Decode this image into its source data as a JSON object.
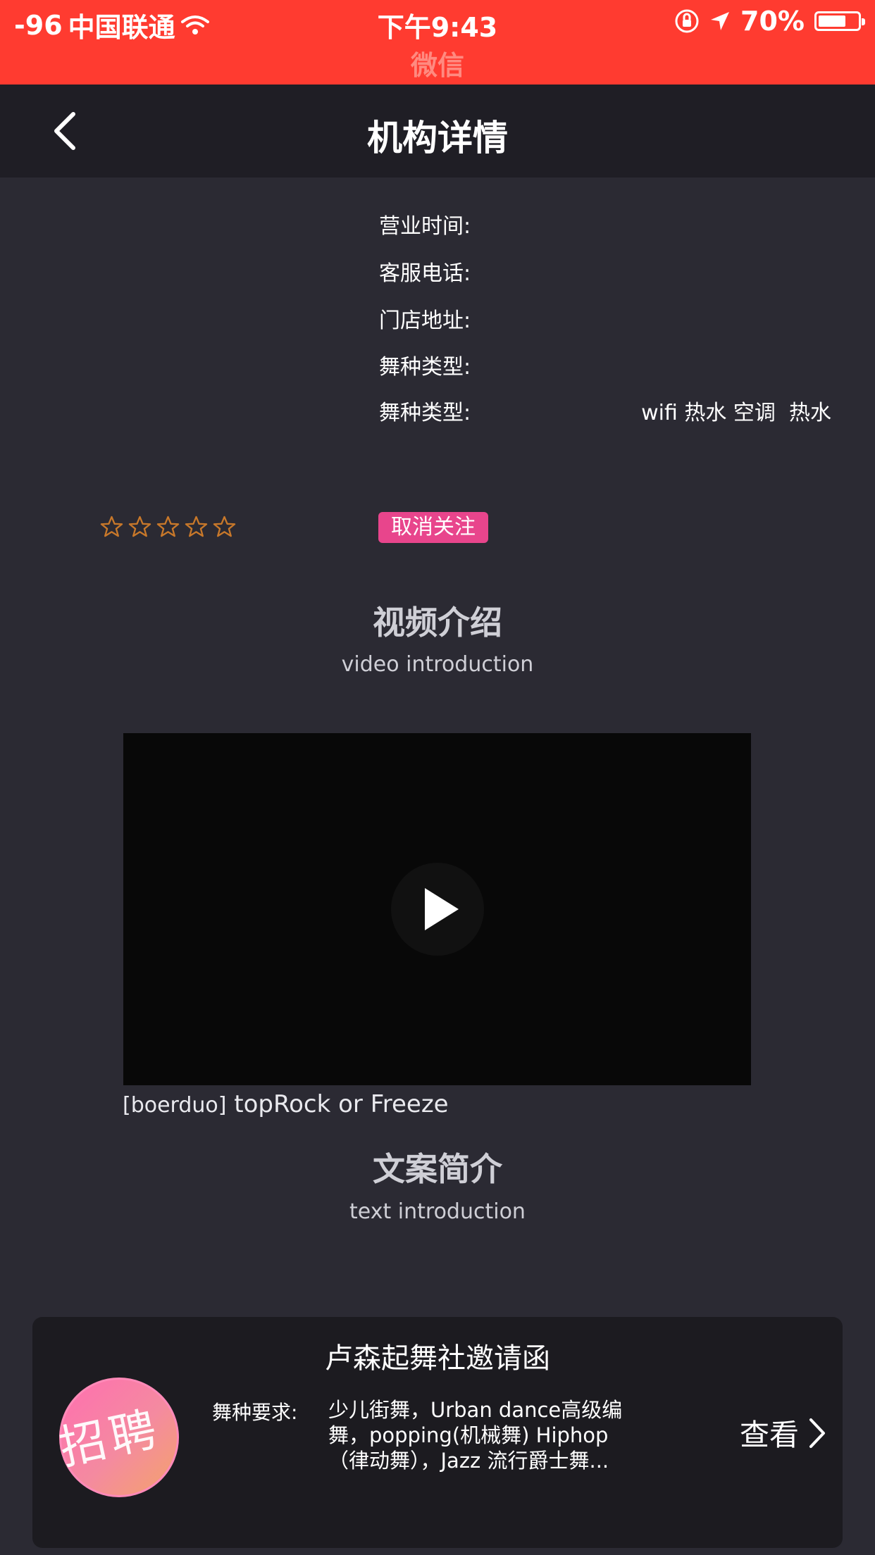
{
  "status_bar": {
    "signal": "-96",
    "carrier": "中国联通",
    "time": "下午9:43",
    "back_app": "微信",
    "battery": "70%",
    "battery_level": 0.7
  },
  "nav": {
    "title": "机构详情"
  },
  "info": {
    "hours_label": "营业时间:",
    "phone_label": "客服电话:",
    "address_label": "门店地址:",
    "dance_type_label": "舞种类型:",
    "facilities_label": "舞种类型:",
    "facilities": "wifi 热水 空调  热水"
  },
  "rating": {
    "stars_filled": 0,
    "stars_total": 5
  },
  "follow_button": "取消关注",
  "video_section": {
    "title": "视频介绍",
    "subtitle": "video introduction",
    "caption_tag": "[boerduo]",
    "caption_title": "topRock or Freeze"
  },
  "text_section": {
    "title": "文案简介",
    "subtitle": "text introduction"
  },
  "invitation": {
    "title": "卢森起舞社邀请函",
    "badge_text": "招聘",
    "requirement_label": "舞种要求:",
    "requirement_text": "少儿街舞，Urban dance高级编舞，popping(机械舞) Hiphop（律动舞），Jazz 流行爵士舞...",
    "view_button": "查看"
  },
  "colors": {
    "status_bar": "#ff3b30",
    "nav_bg": "#1f1e25",
    "page_bg": "#2b2a33",
    "accent_pink": "#e8458c",
    "star_outline": "#c8782a"
  }
}
